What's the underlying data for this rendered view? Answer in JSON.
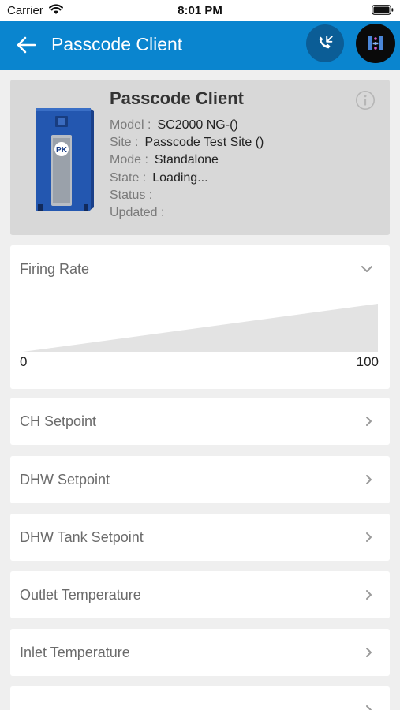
{
  "status_bar": {
    "carrier": "Carrier",
    "time": "8:01 PM"
  },
  "app_bar": {
    "title": "Passcode Client",
    "background": "#0a85cf"
  },
  "device": {
    "name": "Passcode Client",
    "info": [
      {
        "label": "Model :",
        "value": "SC2000 NG-()"
      },
      {
        "label": "Site :",
        "value": "Passcode Test Site ()"
      },
      {
        "label": "Mode :",
        "value": "Standalone"
      },
      {
        "label": "State :",
        "value": "Loading..."
      },
      {
        "label": "Status :",
        "value": ""
      },
      {
        "label": "Updated :",
        "value": ""
      }
    ]
  },
  "firing_rate": {
    "title": "Firing Rate",
    "min_label": "0",
    "max_label": "100"
  },
  "list_items": [
    {
      "label": "CH Setpoint"
    },
    {
      "label": "DHW Setpoint"
    },
    {
      "label": "DHW Tank Setpoint"
    },
    {
      "label": "Outlet Temperature"
    },
    {
      "label": "Inlet Temperature"
    }
  ],
  "icons": [
    "wifi-icon",
    "battery-icon",
    "back-arrow-icon",
    "phone-call-icon",
    "app-logo-icon",
    "info-icon",
    "chevron-down-icon",
    "chevron-right-icon"
  ]
}
